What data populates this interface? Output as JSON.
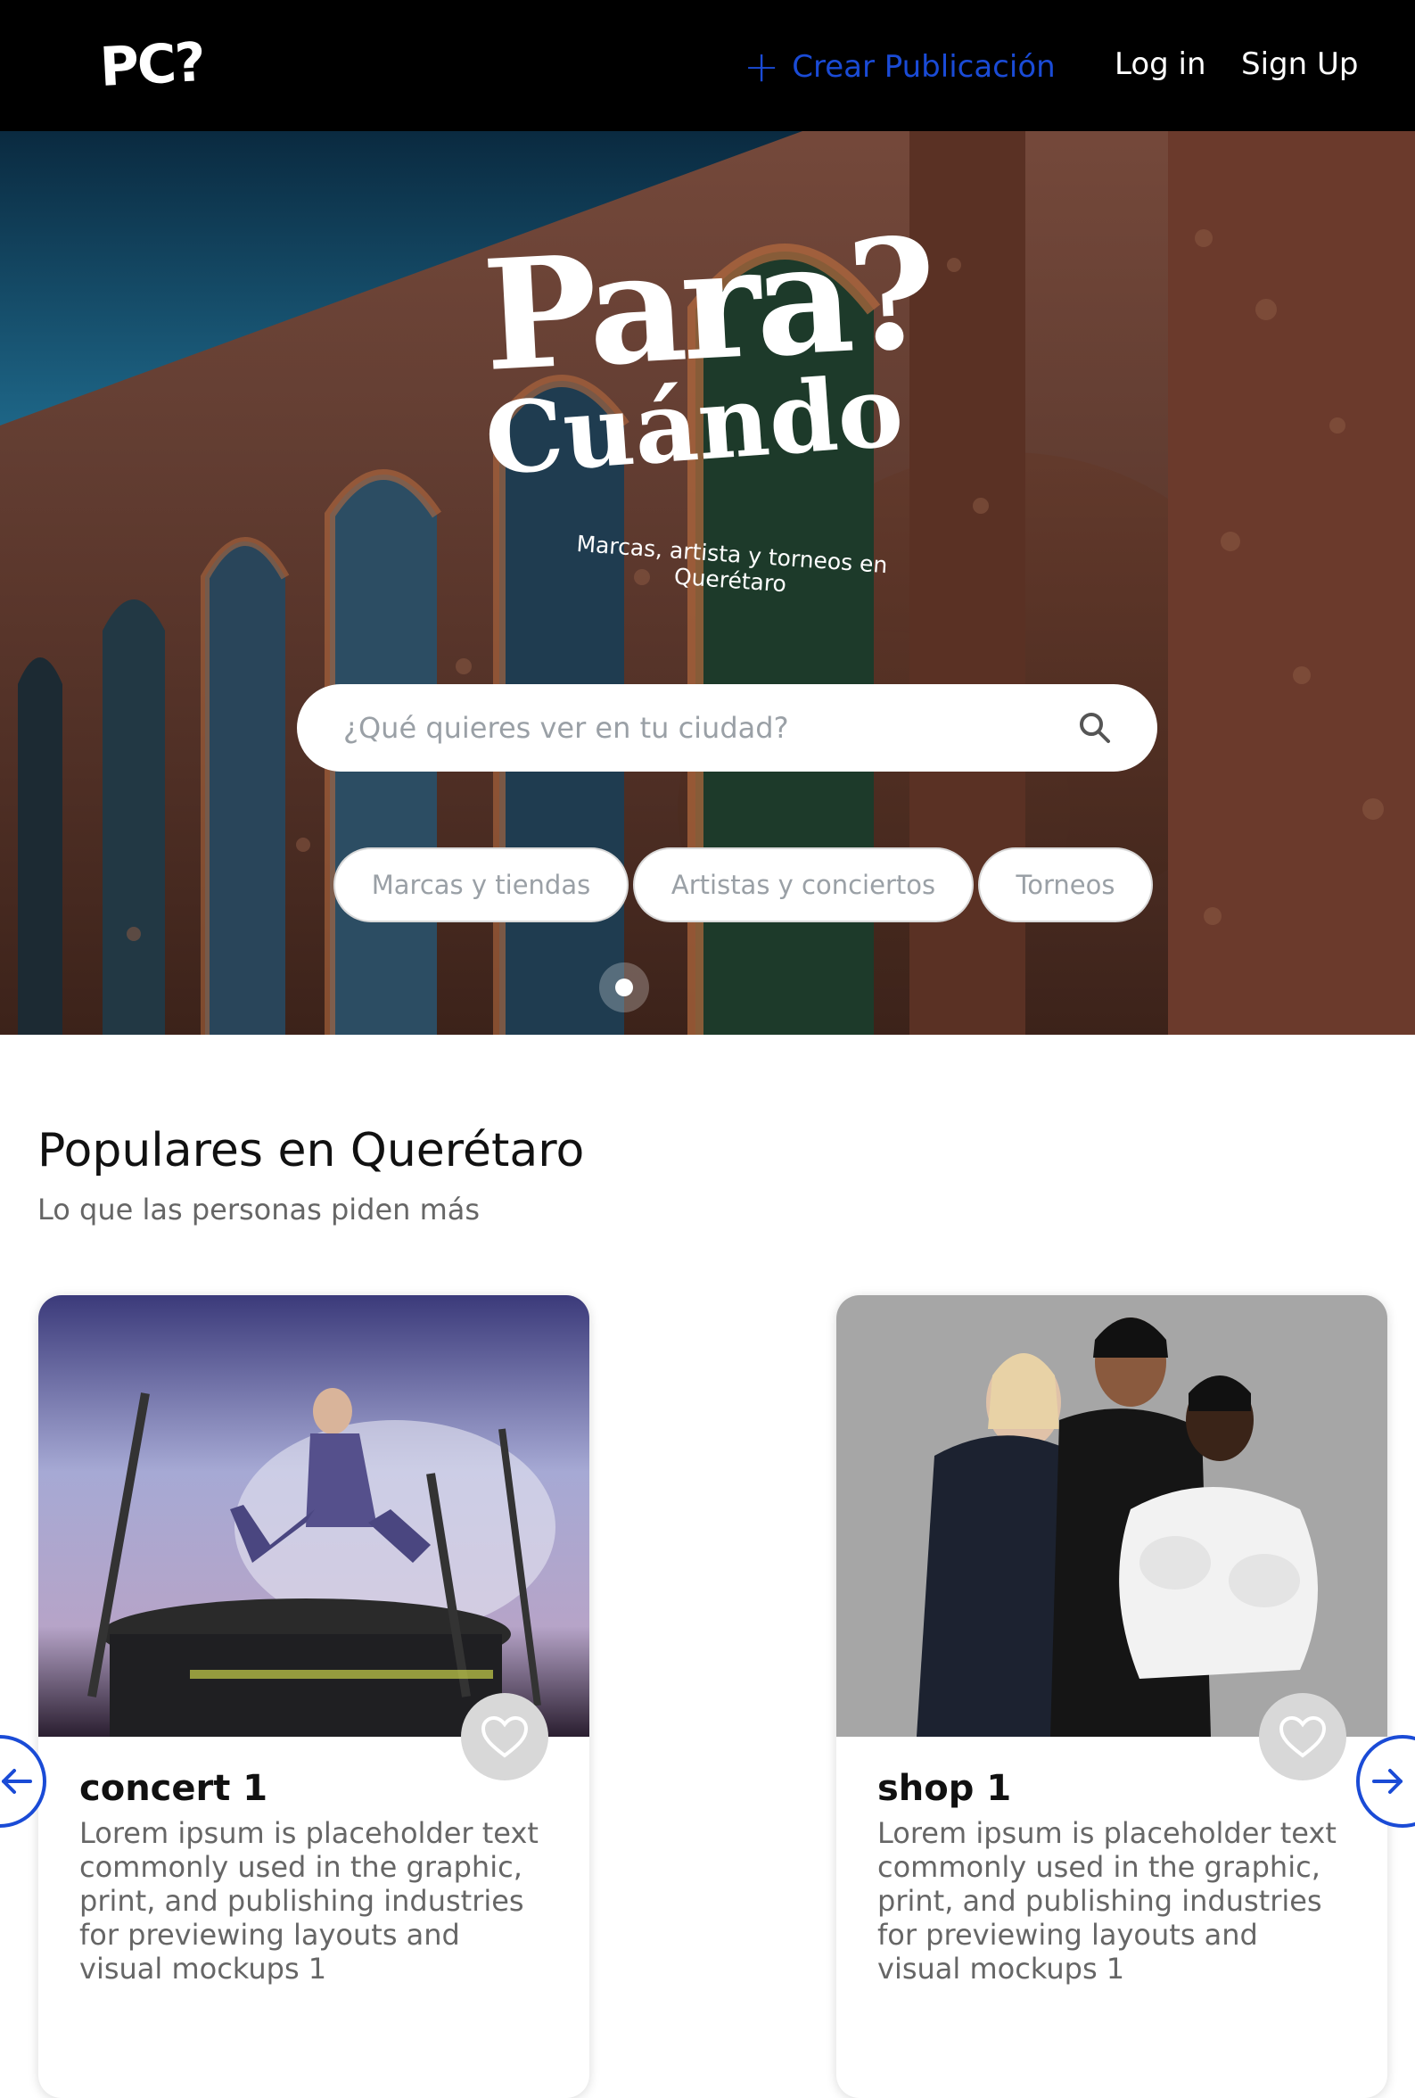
{
  "navbar": {
    "logo": "PC?",
    "create_label": "Crear Publicación",
    "login_label": "Log in",
    "signup_label": "Sign Up"
  },
  "hero": {
    "title_line1": "Para?",
    "title_line2": "Cuándo",
    "tagline": "Marcas, artista y torneos en Querétaro",
    "search_placeholder": "¿Qué quieres ver en tu ciudad?",
    "chips": [
      "Marcas y tiendas",
      "Artistas y conciertos",
      "Torneos"
    ]
  },
  "section": {
    "title": "Populares en Querétaro",
    "subtitle": "Lo que las personas piden más"
  },
  "cards": [
    {
      "title": "concert 1",
      "description": "Lorem ipsum is placeholder text commonly used in the graphic, print, and publishing industries for previewing layouts and visual mockups 1"
    },
    {
      "title": "shop 1",
      "description": "Lorem ipsum is placeholder text commonly used in the graphic, print, and publishing industries for previewing layouts and visual mockups 1"
    }
  ],
  "colors": {
    "accent": "#1a4bd6",
    "navbar_bg": "#000000",
    "fav_bg": "#d8d8d8"
  },
  "icons": {
    "create": "plus-icon",
    "search": "search-icon",
    "favorite": "heart-icon",
    "prev": "arrow-left-icon",
    "next": "arrow-right-icon"
  }
}
